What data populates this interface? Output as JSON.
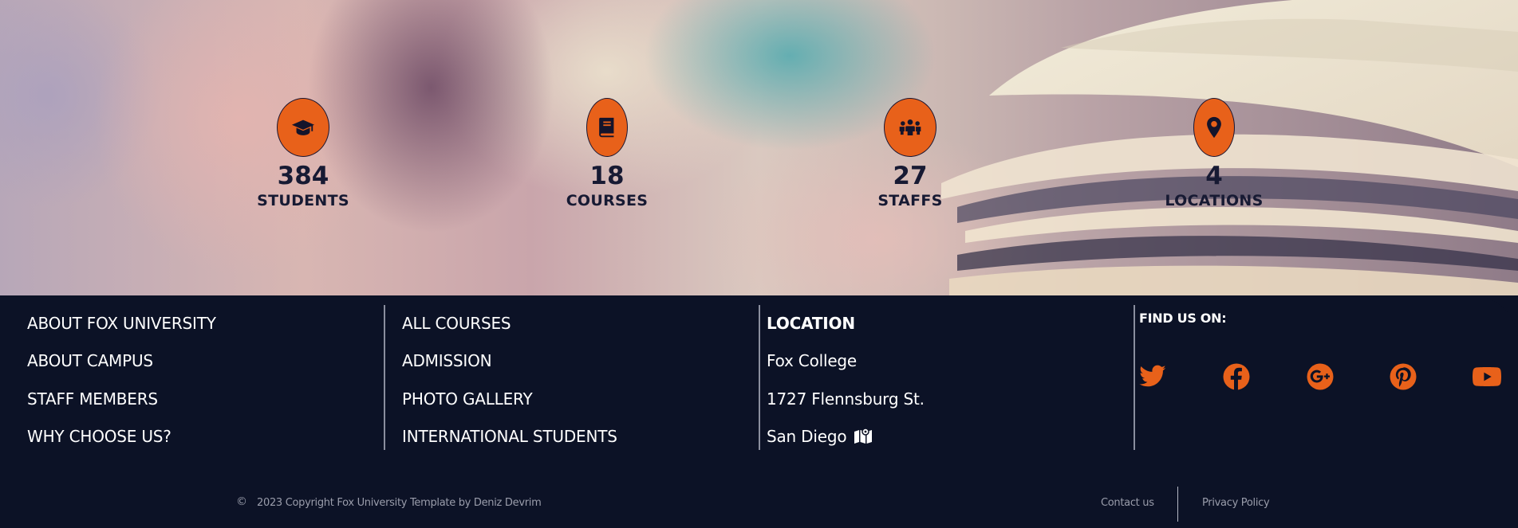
{
  "stats": [
    {
      "icon": "graduation-cap-icon",
      "value": "384",
      "label": "STUDENTS"
    },
    {
      "icon": "book-icon",
      "value": "18",
      "label": "COURSES"
    },
    {
      "icon": "people-group-icon",
      "value": "27",
      "label": "STAFFS"
    },
    {
      "icon": "map-marker-icon",
      "value": "4",
      "label": "LOCATIONS"
    }
  ],
  "footer": {
    "col1": [
      "ABOUT FOX UNIVERSITY",
      "ABOUT CAMPUS",
      "STAFF MEMBERS",
      "WHY CHOOSE US?"
    ],
    "col2": [
      "ALL COURSES",
      "ADMISSION",
      "PHOTO GALLERY",
      "INTERNATIONAL STUDENTS"
    ],
    "location": {
      "title": "LOCATION",
      "name": "Fox College",
      "street": "1727 Flennsburg St.",
      "city": "San Diego",
      "city_icon": "map-location-icon"
    },
    "social": {
      "title": "FIND US ON:",
      "icons": [
        "twitter-icon",
        "facebook-icon",
        "google-plus-icon",
        "pinterest-icon",
        "youtube-icon"
      ]
    },
    "bottom": {
      "copyright_symbol": "©",
      "copyright": "2023 Copyright Fox University Template by Deniz Devrim",
      "contact": "Contact us",
      "privacy": "Privacy Policy"
    }
  },
  "colors": {
    "accent": "#e8611a",
    "navy": "#0c1226",
    "text_dark": "#171a33"
  }
}
